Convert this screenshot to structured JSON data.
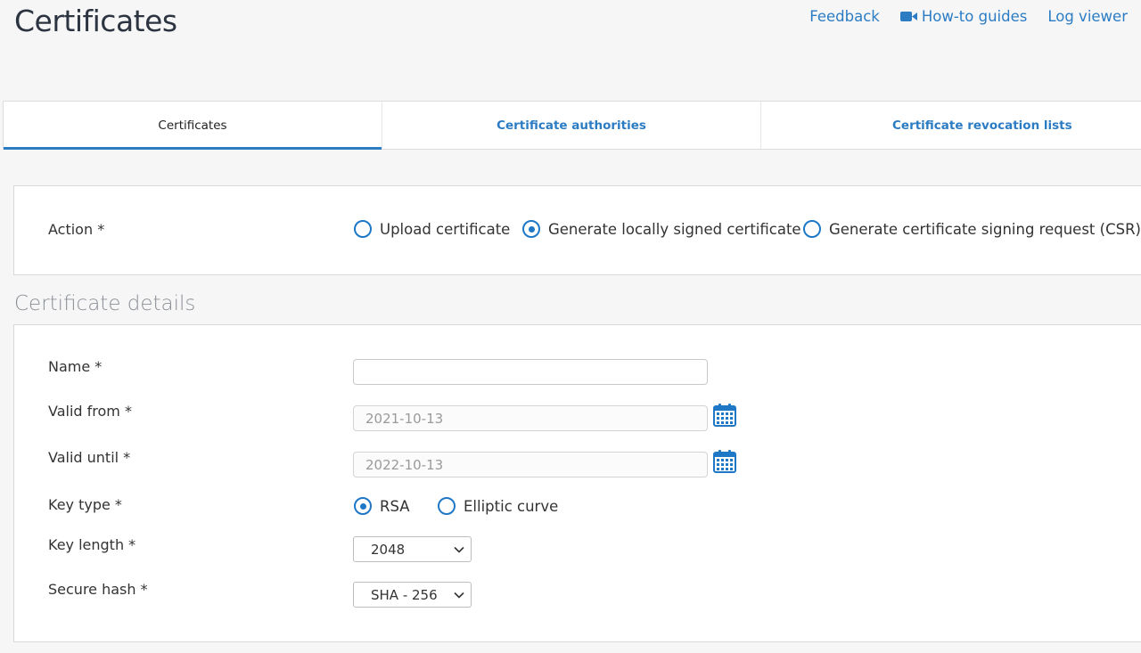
{
  "header": {
    "title": "Certificates",
    "links": {
      "feedback": "Feedback",
      "howto": "How-to guides",
      "logviewer": "Log viewer"
    }
  },
  "tabs": [
    {
      "label": "Certificates",
      "active": true
    },
    {
      "label": "Certificate authorities",
      "active": false
    },
    {
      "label": "Certificate revocation lists",
      "active": false
    }
  ],
  "action": {
    "label": "Action *",
    "options": [
      {
        "label": "Upload certificate",
        "selected": false
      },
      {
        "label": "Generate locally signed certificate",
        "selected": true
      },
      {
        "label": "Generate certificate signing request (CSR)",
        "selected": false
      }
    ]
  },
  "details": {
    "section_title": "Certificate details",
    "name": {
      "label": "Name *",
      "value": "",
      "placeholder": ""
    },
    "valid_from": {
      "label": "Valid from *",
      "value": "2021-10-13"
    },
    "valid_until": {
      "label": "Valid until *",
      "value": "2022-10-13"
    },
    "key_type": {
      "label": "Key type *",
      "options": [
        {
          "label": "RSA",
          "selected": true
        },
        {
          "label": "Elliptic curve",
          "selected": false
        }
      ]
    },
    "key_length": {
      "label": "Key length *",
      "value": "2048"
    },
    "secure_hash": {
      "label": "Secure hash *",
      "value": "SHA - 256"
    }
  },
  "icons": {
    "howto": "video-camera-icon",
    "calendar": "calendar-icon",
    "dropdown": "chevron-down-icon"
  },
  "colors": {
    "accent": "#2c7cc4",
    "radio": "#1f78c6",
    "background": "#f6f6f6"
  }
}
